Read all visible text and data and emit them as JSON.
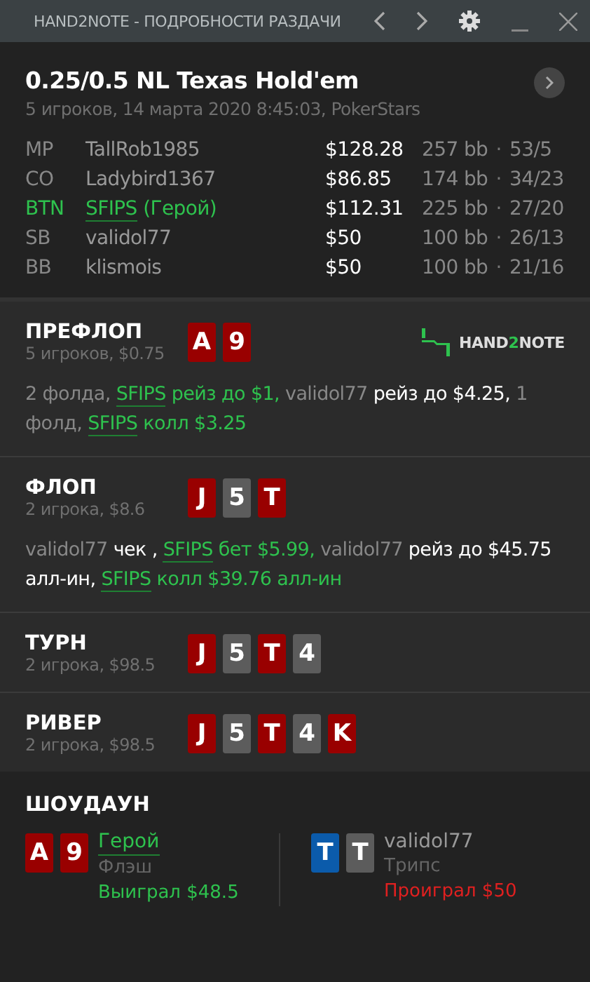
{
  "window": {
    "title": "HAND2NOTE - ПОДРОБНОСТИ РАЗДАЧИ"
  },
  "header": {
    "title": "0.25/0.5 NL Texas Hold'em",
    "subtitle": "5 игроков, 14 марта 2020 8:45:03, PokerStars"
  },
  "players": [
    {
      "position": "MP",
      "name": "TallRob1985",
      "hero": false,
      "stack": "$128.28",
      "bb": "257 bb",
      "sep": "·",
      "stats": "53/5"
    },
    {
      "position": "CO",
      "name": "Ladybird1367",
      "hero": false,
      "stack": "$86.85",
      "bb": "174 bb",
      "sep": "·",
      "stats": "34/23"
    },
    {
      "position": "BTN",
      "name": "SFIPS",
      "suffix": "(Герой)",
      "hero": true,
      "stack": "$112.31",
      "bb": "225 bb",
      "sep": "·",
      "stats": "27/20"
    },
    {
      "position": "SB",
      "name": "validol77",
      "hero": false,
      "stack": "$50",
      "bb": "100 bb",
      "sep": "·",
      "stats": "26/13"
    },
    {
      "position": "BB",
      "name": "klismois",
      "hero": false,
      "stack": "$50",
      "bb": "100 bb",
      "sep": "·",
      "stats": "21/16"
    }
  ],
  "logo": {
    "before": "HAND",
    "highlight": "2",
    "after": "NOTE"
  },
  "streets": [
    {
      "name": "ПРЕФЛОП",
      "info": "5 игроков, $0.75",
      "logo": true,
      "cards": [
        {
          "rank": "A",
          "color": "#990000"
        },
        {
          "rank": "9",
          "color": "#990000"
        }
      ],
      "actions": [
        {
          "kind": "plain",
          "text": "2 фолда, "
        },
        {
          "kind": "hero",
          "text": "SFIPS"
        },
        {
          "kind": "hero_action",
          "text": " рейз до $1, "
        },
        {
          "kind": "name",
          "text": "validol77"
        },
        {
          "kind": "action",
          "text": " рейз до $4.25, "
        },
        {
          "kind": "plain",
          "text": "1 фолд, "
        },
        {
          "kind": "hero",
          "text": "SFIPS"
        },
        {
          "kind": "hero_action",
          "text": " колл $3.25"
        }
      ]
    },
    {
      "name": "ФЛОП",
      "info": "2 игрока, $8.6",
      "logo": false,
      "cards": [
        {
          "rank": "J",
          "color": "#990000"
        },
        {
          "rank": "5",
          "color": "#5c5c5c"
        },
        {
          "rank": "T",
          "color": "#990000"
        }
      ],
      "actions": [
        {
          "kind": "name",
          "text": "validol77"
        },
        {
          "kind": "action",
          "text": " чек , "
        },
        {
          "kind": "hero",
          "text": "SFIPS"
        },
        {
          "kind": "hero_action",
          "text": " бет $5.99, "
        },
        {
          "kind": "name",
          "text": "validol77"
        },
        {
          "kind": "action",
          "text": " рейз до $45.75 алл-ин, "
        },
        {
          "kind": "hero",
          "text": "SFIPS"
        },
        {
          "kind": "hero_action",
          "text": " колл $39.76 алл-ин"
        }
      ]
    },
    {
      "name": "ТУРН",
      "info": "2 игрока, $98.5",
      "logo": false,
      "cards": [
        {
          "rank": "J",
          "color": "#990000"
        },
        {
          "rank": "5",
          "color": "#5c5c5c"
        },
        {
          "rank": "T",
          "color": "#990000"
        },
        {
          "rank": "4",
          "color": "#5c5c5c"
        }
      ]
    },
    {
      "name": "РИВЕР",
      "info": "2 игрока, $98.5",
      "logo": false,
      "cards": [
        {
          "rank": "J",
          "color": "#990000"
        },
        {
          "rank": "5",
          "color": "#5c5c5c"
        },
        {
          "rank": "T",
          "color": "#990000"
        },
        {
          "rank": "4",
          "color": "#5c5c5c"
        },
        {
          "rank": "K",
          "color": "#990000"
        }
      ]
    }
  ],
  "showdown": {
    "title": "ШОУДАУН",
    "players": [
      {
        "name": "Герой",
        "hero": true,
        "hand": "Флэш",
        "result": "Выиграл $48.5",
        "won": true,
        "cards": [
          {
            "rank": "A",
            "color": "#990000"
          },
          {
            "rank": "9",
            "color": "#990000"
          }
        ]
      },
      {
        "name": "validol77",
        "hero": false,
        "hand": "Трипс",
        "result": "Проиграл $50",
        "won": false,
        "cards": [
          {
            "rank": "T",
            "color": "#0b5bab"
          },
          {
            "rank": "T",
            "color": "#5c5c5c"
          }
        ]
      }
    ]
  }
}
